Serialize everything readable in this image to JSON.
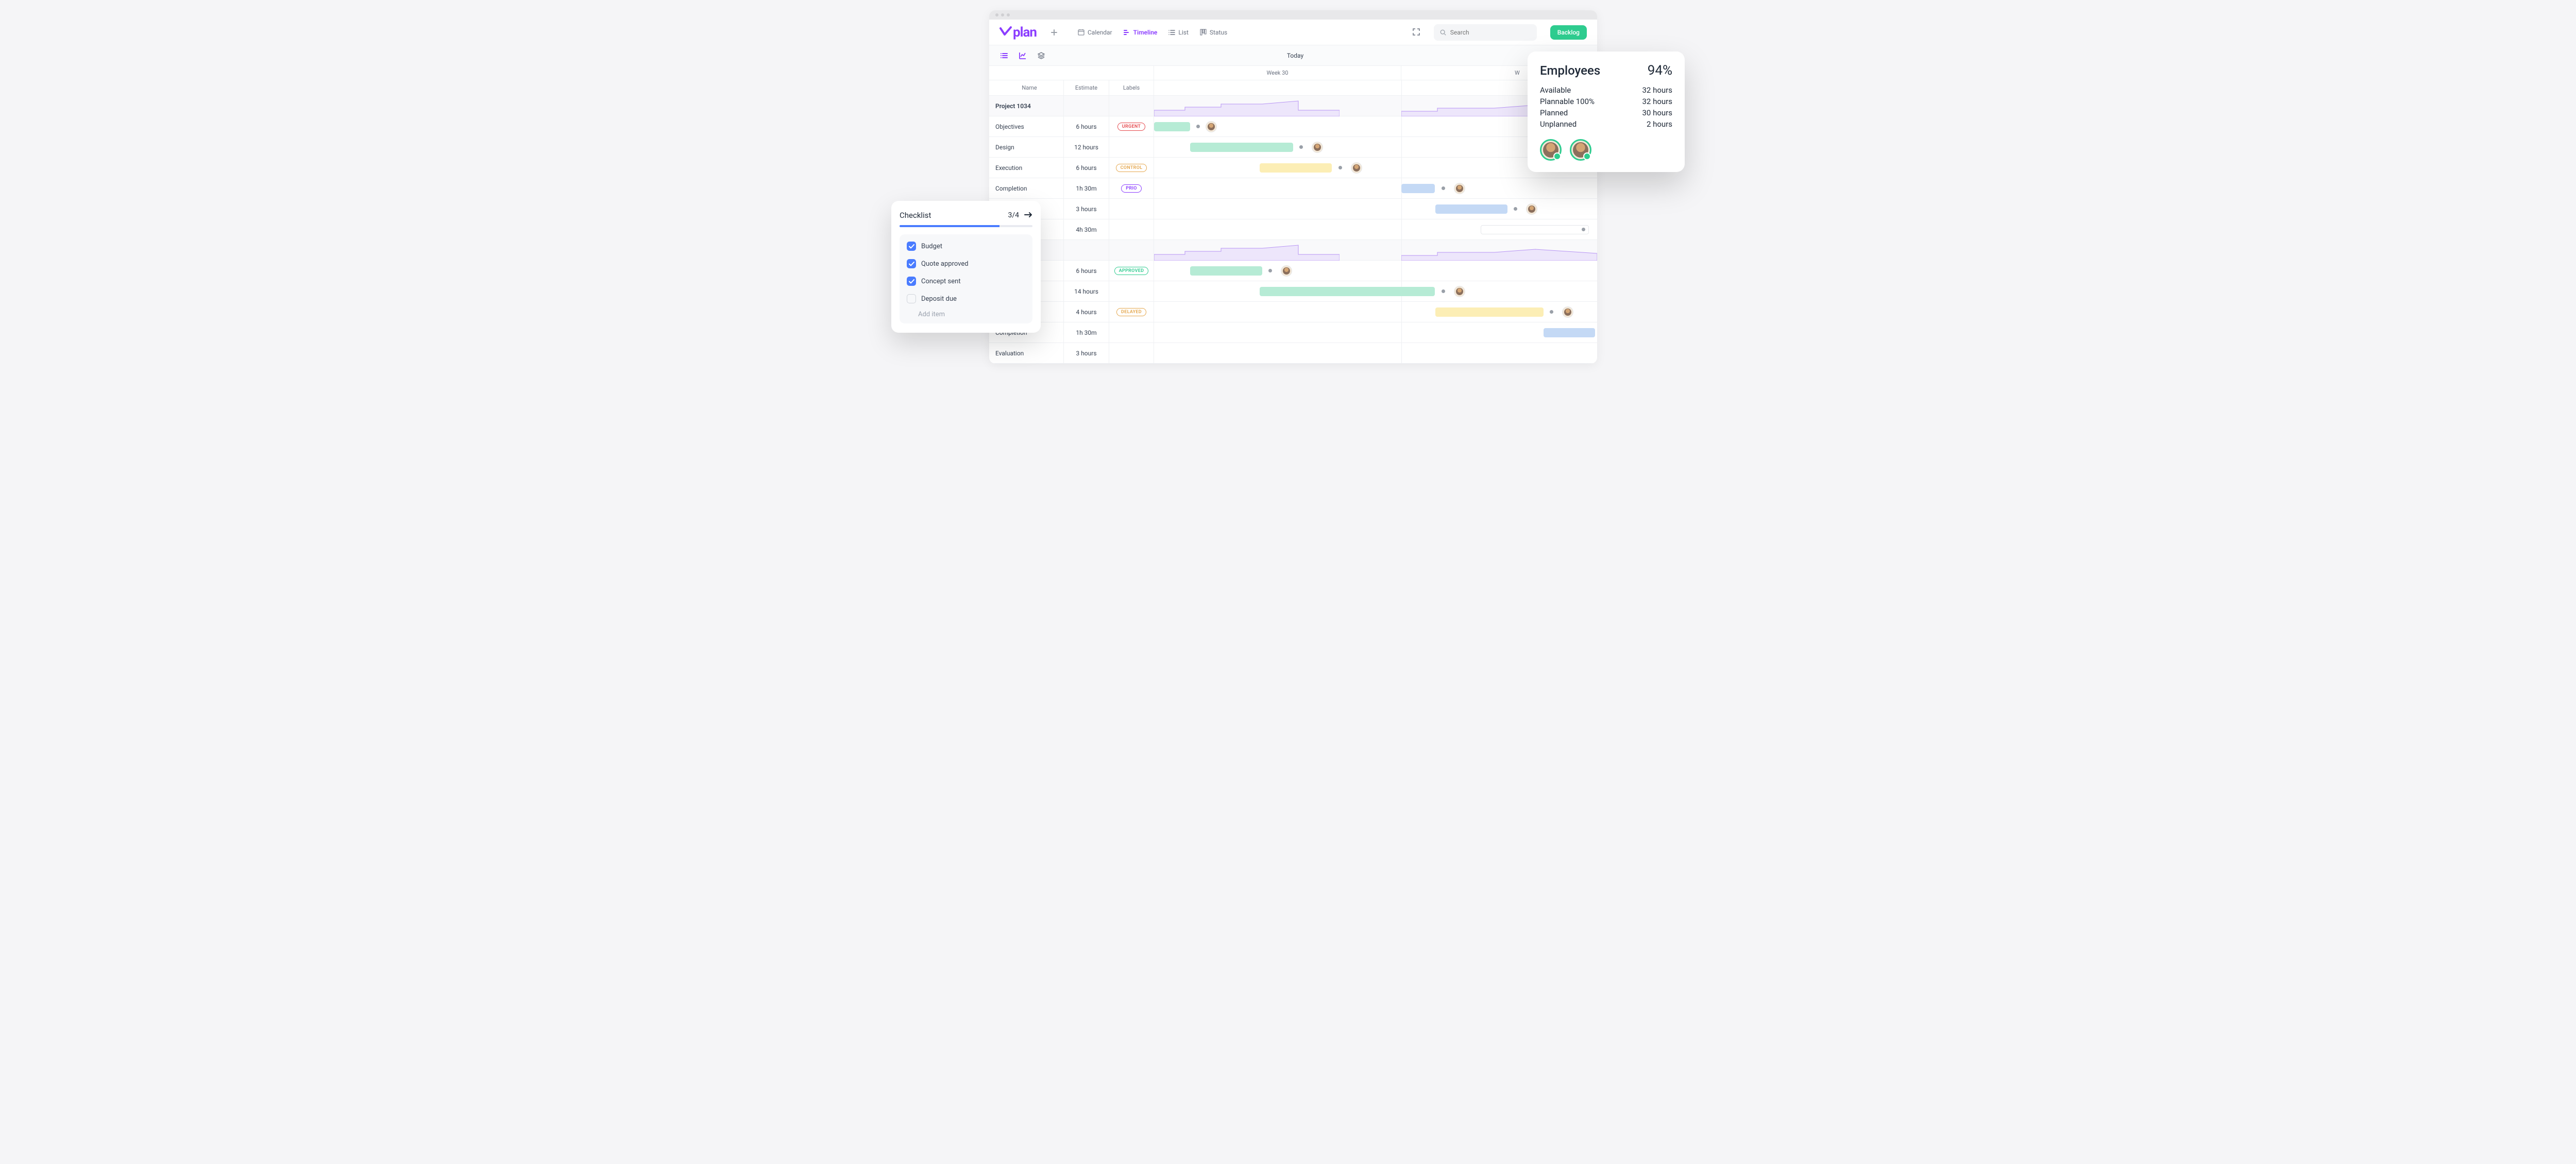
{
  "logo": "plan",
  "views": {
    "calendar": "Calendar",
    "timeline": "Timeline",
    "list": "List",
    "status": "Status"
  },
  "search": {
    "placeholder": "Search"
  },
  "backlog_label": "Backlog",
  "today_label": "Today",
  "weeks": {
    "w30": "Week 30",
    "w31": "W"
  },
  "columns": {
    "name": "Name",
    "estimate": "Estimate",
    "labels": "Labels"
  },
  "rows": [
    {
      "type": "project",
      "name": "Project 1034"
    },
    {
      "type": "task",
      "name": "Objectives",
      "estimate": "6 hours",
      "label": "URGENT",
      "label_class": "urgent"
    },
    {
      "type": "task",
      "name": "Design",
      "estimate": "12 hours",
      "label": ""
    },
    {
      "type": "task",
      "name": "Execution",
      "estimate": "6 hours",
      "label": "CONTROL",
      "label_class": "control"
    },
    {
      "type": "task",
      "name": "Completion",
      "estimate": "1h 30m",
      "label": "PRIO",
      "label_class": "prio"
    },
    {
      "type": "task",
      "name": "",
      "estimate": "3 hours",
      "label": ""
    },
    {
      "type": "task",
      "name": "",
      "estimate": "4h 30m",
      "label": ""
    },
    {
      "type": "project",
      "name": ""
    },
    {
      "type": "task",
      "name": "",
      "estimate": "6 hours",
      "label": "APPROVED",
      "label_class": "approved"
    },
    {
      "type": "task",
      "name": "",
      "estimate": "14 hours",
      "label": ""
    },
    {
      "type": "task",
      "name": "",
      "estimate": "4 hours",
      "label": "DELAYED",
      "label_class": "delayed"
    },
    {
      "type": "task",
      "name": "Completion",
      "estimate": "1h 30m",
      "label": ""
    },
    {
      "type": "task",
      "name": "Evaluation",
      "estimate": "3 hours",
      "label": ""
    }
  ],
  "checklist": {
    "title": "Checklist",
    "count": "3/4",
    "items": [
      {
        "label": "Budget",
        "done": true
      },
      {
        "label": "Quote approved",
        "done": true
      },
      {
        "label": "Concept sent",
        "done": true
      },
      {
        "label": "Deposit due",
        "done": false
      }
    ],
    "add": "Add item"
  },
  "employees": {
    "title": "Employees",
    "percent": "94%",
    "rows": [
      {
        "label": "Available",
        "value": "32 hours"
      },
      {
        "label": "Plannable 100%",
        "value": "32 hours"
      },
      {
        "label": "Planned",
        "value": "30 hours"
      },
      {
        "label": "Unplanned",
        "value": "2 hours"
      }
    ]
  }
}
